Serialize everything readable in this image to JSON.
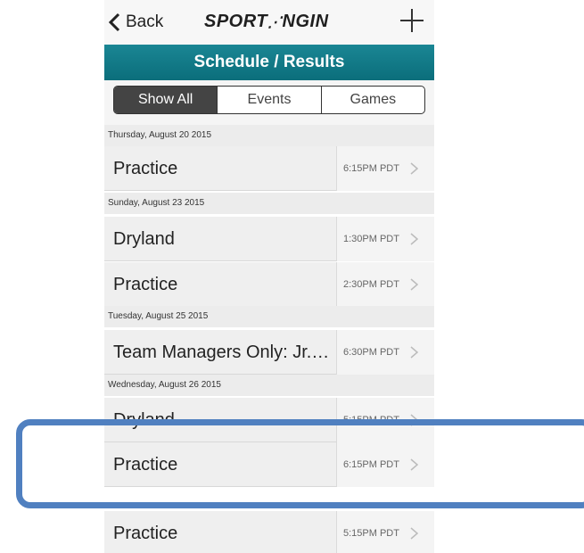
{
  "nav": {
    "back_label": "Back",
    "logo_text": "SPORT",
    "logo_mark": "⋰",
    "logo_text2": "NGIN"
  },
  "title": "Schedule / Results",
  "tabs": [
    "Show All",
    "Events",
    "Games"
  ],
  "schedule": [
    {
      "date": "Thursday, August 20 2015",
      "events": [
        {
          "name": "Practice",
          "time": "6:15PM PDT"
        }
      ]
    },
    {
      "date": "Sunday, August 23 2015",
      "events": [
        {
          "name": "Dryland",
          "time": "1:30PM PDT"
        },
        {
          "name": "Practice",
          "time": "2:30PM PDT"
        }
      ]
    },
    {
      "date": "Tuesday, August 25 2015",
      "events": [
        {
          "name": "Team Managers Only: Jr.…",
          "time": "6:30PM PDT"
        }
      ]
    },
    {
      "date": "Wednesday, August 26 2015",
      "events": [
        {
          "name": "Dryland",
          "time": "5:15PM PDT"
        },
        {
          "name": "Practice",
          "time": "6:15PM PDT"
        },
        {
          "name": "Practice",
          "time": "5:15PM PDT"
        }
      ]
    }
  ],
  "accent": "#0b6e7b",
  "highlight_color": "#5080c0"
}
